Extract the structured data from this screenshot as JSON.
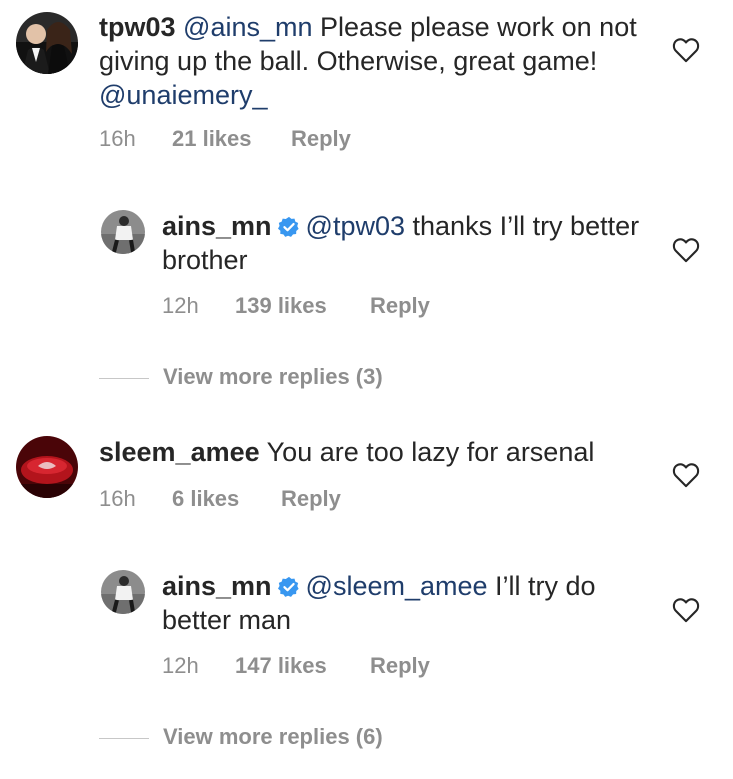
{
  "comments": [
    {
      "username": "tpw03",
      "mention1": "@ains_mn",
      "text": " Please please work on not giving up the ball. Otherwise, great game! ",
      "mention2": "@unaiemery_",
      "time": "16h",
      "likes": "21 likes",
      "reply": "Reply"
    },
    {
      "username": "ains_mn",
      "mention": "@tpw03",
      "text": " thanks I’ll try better brother",
      "time": "12h",
      "likes": "139 likes",
      "reply": "Reply"
    },
    {
      "view_more": "View more replies (3)"
    },
    {
      "username": "sleem_amee",
      "text": " You are too lazy for arsenal",
      "time": "16h",
      "likes": "6 likes",
      "reply": "Reply"
    },
    {
      "username": "ains_mn",
      "mention": "@sleem_amee",
      "text": " I’ll try do better man",
      "time": "12h",
      "likes": "147 likes",
      "reply": "Reply"
    },
    {
      "view_more": "View more replies (6)"
    }
  ],
  "colors": {
    "text": "#262626",
    "mention": "#1f3d6b",
    "meta": "#8e8e8e",
    "verified": "#3897f0"
  },
  "icons": [
    "heart-outline-icon",
    "verified-badge-icon"
  ]
}
